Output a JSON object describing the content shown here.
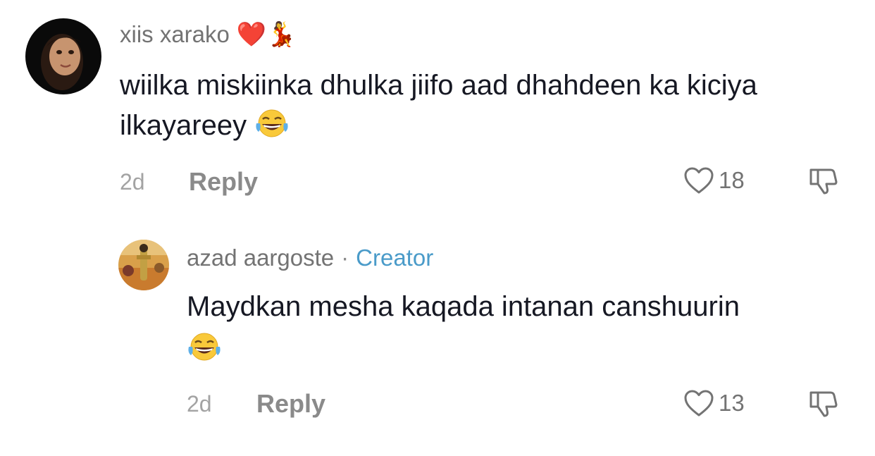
{
  "comments": [
    {
      "username": "xiis xarako",
      "username_emojis": "❤️💃",
      "text": "wiilka miskiinka dhulka jiifo aad dhahdeen ka kiciya ilkayareey",
      "emoji_icon": "face-with-tears-of-joy",
      "age": "2d",
      "reply_label": "Reply",
      "likes": "18"
    },
    {
      "username": "azad aargoste",
      "separator": "·",
      "badge": "Creator",
      "text": "Maydkan mesha kaqada intanan canshuurin",
      "emoji_icon": "face-with-tears-of-joy",
      "age": "2d",
      "reply_label": "Reply",
      "likes": "13"
    }
  ],
  "colors": {
    "badge": "#4a9bc9",
    "username": "#737373",
    "text": "#161823",
    "meta": "#a3a3a3"
  }
}
